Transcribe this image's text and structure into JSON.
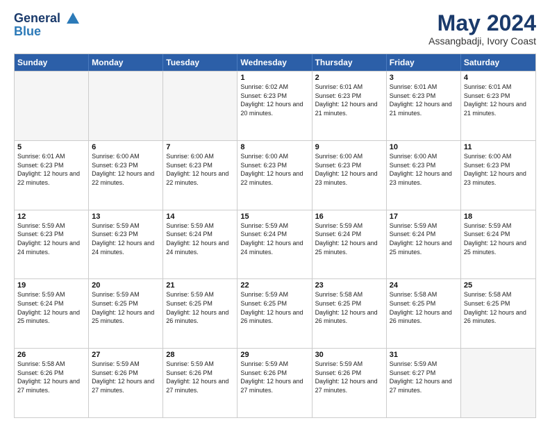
{
  "header": {
    "logo_line1": "General",
    "logo_line2": "Blue",
    "month": "May 2024",
    "location": "Assangbadji, Ivory Coast"
  },
  "days_of_week": [
    "Sunday",
    "Monday",
    "Tuesday",
    "Wednesday",
    "Thursday",
    "Friday",
    "Saturday"
  ],
  "weeks": [
    [
      {
        "day": "",
        "empty": true
      },
      {
        "day": "",
        "empty": true
      },
      {
        "day": "",
        "empty": true
      },
      {
        "day": "1",
        "sunrise": "6:02 AM",
        "sunset": "6:23 PM",
        "daylight": "12 hours and 20 minutes."
      },
      {
        "day": "2",
        "sunrise": "6:01 AM",
        "sunset": "6:23 PM",
        "daylight": "12 hours and 21 minutes."
      },
      {
        "day": "3",
        "sunrise": "6:01 AM",
        "sunset": "6:23 PM",
        "daylight": "12 hours and 21 minutes."
      },
      {
        "day": "4",
        "sunrise": "6:01 AM",
        "sunset": "6:23 PM",
        "daylight": "12 hours and 21 minutes."
      }
    ],
    [
      {
        "day": "5",
        "sunrise": "6:01 AM",
        "sunset": "6:23 PM",
        "daylight": "12 hours and 22 minutes."
      },
      {
        "day": "6",
        "sunrise": "6:00 AM",
        "sunset": "6:23 PM",
        "daylight": "12 hours and 22 minutes."
      },
      {
        "day": "7",
        "sunrise": "6:00 AM",
        "sunset": "6:23 PM",
        "daylight": "12 hours and 22 minutes."
      },
      {
        "day": "8",
        "sunrise": "6:00 AM",
        "sunset": "6:23 PM",
        "daylight": "12 hours and 22 minutes."
      },
      {
        "day": "9",
        "sunrise": "6:00 AM",
        "sunset": "6:23 PM",
        "daylight": "12 hours and 23 minutes."
      },
      {
        "day": "10",
        "sunrise": "6:00 AM",
        "sunset": "6:23 PM",
        "daylight": "12 hours and 23 minutes."
      },
      {
        "day": "11",
        "sunrise": "6:00 AM",
        "sunset": "6:23 PM",
        "daylight": "12 hours and 23 minutes."
      }
    ],
    [
      {
        "day": "12",
        "sunrise": "5:59 AM",
        "sunset": "6:23 PM",
        "daylight": "12 hours and 24 minutes."
      },
      {
        "day": "13",
        "sunrise": "5:59 AM",
        "sunset": "6:23 PM",
        "daylight": "12 hours and 24 minutes."
      },
      {
        "day": "14",
        "sunrise": "5:59 AM",
        "sunset": "6:24 PM",
        "daylight": "12 hours and 24 minutes."
      },
      {
        "day": "15",
        "sunrise": "5:59 AM",
        "sunset": "6:24 PM",
        "daylight": "12 hours and 24 minutes."
      },
      {
        "day": "16",
        "sunrise": "5:59 AM",
        "sunset": "6:24 PM",
        "daylight": "12 hours and 25 minutes."
      },
      {
        "day": "17",
        "sunrise": "5:59 AM",
        "sunset": "6:24 PM",
        "daylight": "12 hours and 25 minutes."
      },
      {
        "day": "18",
        "sunrise": "5:59 AM",
        "sunset": "6:24 PM",
        "daylight": "12 hours and 25 minutes."
      }
    ],
    [
      {
        "day": "19",
        "sunrise": "5:59 AM",
        "sunset": "6:24 PM",
        "daylight": "12 hours and 25 minutes."
      },
      {
        "day": "20",
        "sunrise": "5:59 AM",
        "sunset": "6:25 PM",
        "daylight": "12 hours and 25 minutes."
      },
      {
        "day": "21",
        "sunrise": "5:59 AM",
        "sunset": "6:25 PM",
        "daylight": "12 hours and 26 minutes."
      },
      {
        "day": "22",
        "sunrise": "5:59 AM",
        "sunset": "6:25 PM",
        "daylight": "12 hours and 26 minutes."
      },
      {
        "day": "23",
        "sunrise": "5:58 AM",
        "sunset": "6:25 PM",
        "daylight": "12 hours and 26 minutes."
      },
      {
        "day": "24",
        "sunrise": "5:58 AM",
        "sunset": "6:25 PM",
        "daylight": "12 hours and 26 minutes."
      },
      {
        "day": "25",
        "sunrise": "5:58 AM",
        "sunset": "6:25 PM",
        "daylight": "12 hours and 26 minutes."
      }
    ],
    [
      {
        "day": "26",
        "sunrise": "5:58 AM",
        "sunset": "6:26 PM",
        "daylight": "12 hours and 27 minutes."
      },
      {
        "day": "27",
        "sunrise": "5:59 AM",
        "sunset": "6:26 PM",
        "daylight": "12 hours and 27 minutes."
      },
      {
        "day": "28",
        "sunrise": "5:59 AM",
        "sunset": "6:26 PM",
        "daylight": "12 hours and 27 minutes."
      },
      {
        "day": "29",
        "sunrise": "5:59 AM",
        "sunset": "6:26 PM",
        "daylight": "12 hours and 27 minutes."
      },
      {
        "day": "30",
        "sunrise": "5:59 AM",
        "sunset": "6:26 PM",
        "daylight": "12 hours and 27 minutes."
      },
      {
        "day": "31",
        "sunrise": "5:59 AM",
        "sunset": "6:27 PM",
        "daylight": "12 hours and 27 minutes."
      },
      {
        "day": "",
        "empty": true
      }
    ]
  ]
}
